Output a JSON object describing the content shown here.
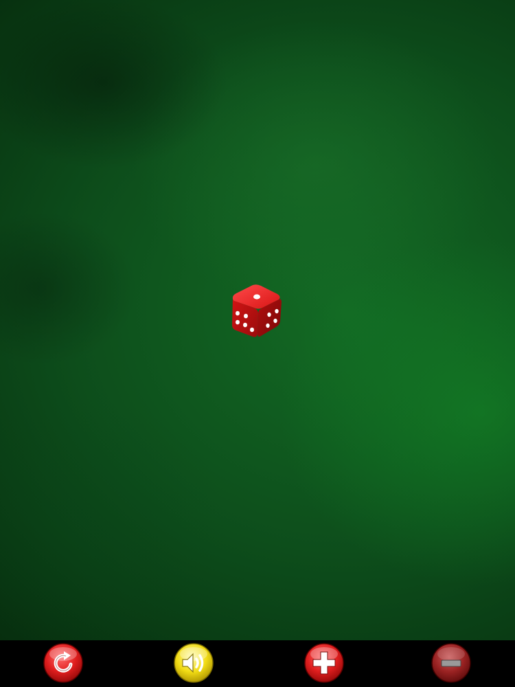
{
  "app": {
    "screen": "dice-table"
  },
  "table": {
    "surface": "green felt",
    "surface_color": "#0d4d1b"
  },
  "die": {
    "color": "#d4141a",
    "pip_color": "#ffffff",
    "top_face_value": 1,
    "left_face_value": 5,
    "right_face_value": 4
  },
  "toolbar": {
    "background": "#000000",
    "buttons": [
      {
        "id": "reroll",
        "icon": "refresh-icon",
        "color": "#d81c1c"
      },
      {
        "id": "sound",
        "icon": "speaker-icon",
        "color": "#f4e21a"
      },
      {
        "id": "add",
        "icon": "plus-icon",
        "color": "#d81c1c"
      },
      {
        "id": "remove",
        "icon": "minus-icon",
        "color": "#9a2222"
      }
    ]
  }
}
